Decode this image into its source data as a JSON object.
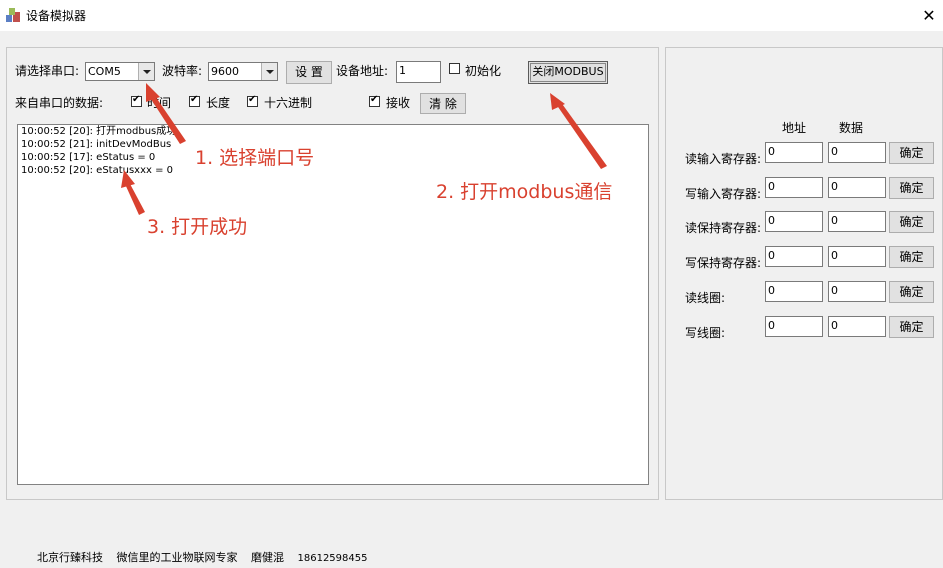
{
  "window": {
    "title": "设备模拟器",
    "close_symbol": "✕"
  },
  "serial": {
    "port_label": "请选择串口:",
    "port_value": "COM5",
    "baud_label": "波特率:",
    "baud_value": "9600",
    "set_button": "设 置",
    "address_label": "设备地址:",
    "address_value": "1",
    "init_label": "初始化",
    "init_checked": false,
    "modbus_button": "关闭MODBUS"
  },
  "data_options": {
    "label": "来自串口的数据:",
    "time_label": "时间",
    "time_checked": true,
    "length_label": "长度",
    "length_checked": true,
    "hex_label": "十六进制",
    "hex_checked": true,
    "receive_label": "接收",
    "receive_checked": true,
    "clear_button": "清 除"
  },
  "log": [
    "10:00:52  [20]: 打开modbus成功",
    "10:00:52  [21]: initDevModBus",
    "10:00:52  [17]: eStatus = 0",
    "10:00:52  [20]: eStatusxxx = 0"
  ],
  "registers": {
    "col_address": "地址",
    "col_data": "数据",
    "confirm_label": "确定",
    "rows": [
      {
        "label": "读输入寄存器:",
        "address": "0",
        "data": "0"
      },
      {
        "label": "写输入寄存器:",
        "address": "0",
        "data": "0"
      },
      {
        "label": "读保持寄存器:",
        "address": "0",
        "data": "0"
      },
      {
        "label": "写保持寄存器:",
        "address": "0",
        "data": "0"
      },
      {
        "label": "读线圈:",
        "address": "0",
        "data": "0"
      },
      {
        "label": "写线圈:",
        "address": "0",
        "data": "0"
      }
    ]
  },
  "annotations": {
    "step1": "1. 选择端口号",
    "step2": "2. 打开modbus通信",
    "step3": "3. 打开成功",
    "color": "#d9412f"
  },
  "footer": {
    "company": "北京行臻科技",
    "slogan": "微信里的工业物联网专家",
    "person": "磨健混",
    "phone": "18612598455"
  }
}
